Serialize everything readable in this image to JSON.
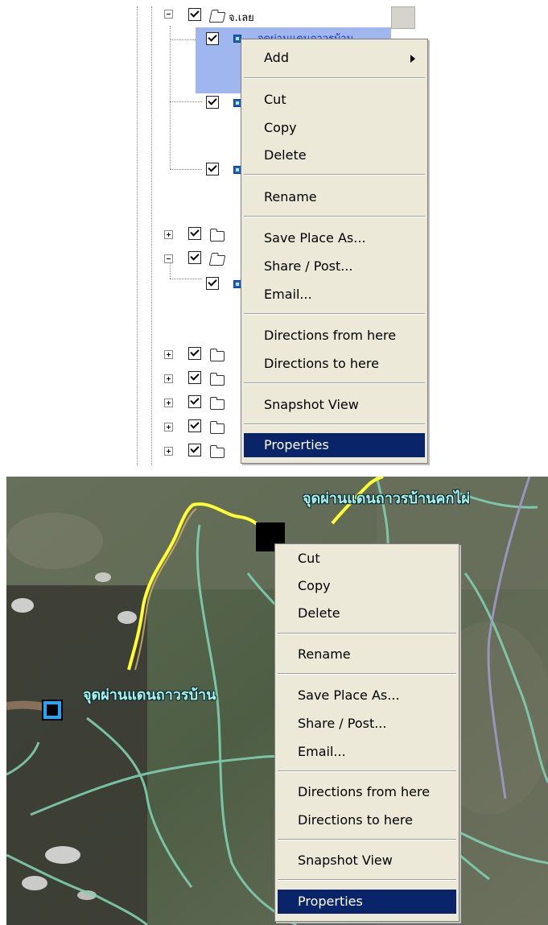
{
  "tree": {
    "top_label": "จ.เลย",
    "selected_label": "จุดผ่านแดนถาวรบ้าน"
  },
  "menu1": {
    "items": [
      "Add",
      "Cut",
      "Copy",
      "Delete",
      "Rename",
      "Save Place As...",
      "Share / Post...",
      "Email...",
      "Directions from here",
      "Directions to here",
      "Snapshot View",
      "Properties"
    ],
    "selected": "Properties"
  },
  "map": {
    "label_top": "จุดผ่านแดนถาวรบ้านคกไผ่",
    "label_left": "จุดผ่านแดนถาวรบ้าน",
    "line_color": "#ffff33",
    "border_color": "#7fd0b0"
  },
  "menu2": {
    "items": [
      "Cut",
      "Copy",
      "Delete",
      "Rename",
      "Save Place As...",
      "Share / Post...",
      "Email...",
      "Directions from here",
      "Directions to here",
      "Snapshot View",
      "Properties"
    ],
    "selected": "Properties"
  }
}
